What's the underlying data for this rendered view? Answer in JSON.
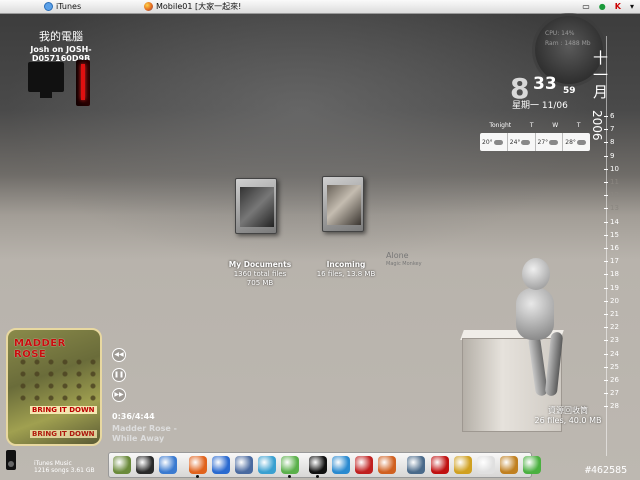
{
  "menubar": {
    "apple_glyph": "",
    "app1": "iTunes",
    "app2": "Mobile01 [大家一起來!",
    "tray_kav": "K",
    "tray_arrow": "▾"
  },
  "mycomputer": {
    "title": "我的電腦",
    "subtitle": "Josh on JOSH-D057160D9B"
  },
  "cpu": {
    "line1": "CPU: 14%",
    "line2": "Ram : 1488 Mb"
  },
  "clock": {
    "hour": "8",
    "minute": "33",
    "second": "59",
    "date": "星期一  11/06",
    "month_chars": [
      "十",
      "一",
      "月"
    ],
    "year": "2006"
  },
  "days": [
    "6",
    "7",
    "8",
    "9",
    "10",
    "11",
    "12",
    "13",
    "14",
    "15",
    "16",
    "17",
    "18",
    "19",
    "20",
    "21",
    "22",
    "23",
    "24",
    "25",
    "26",
    "27",
    "28"
  ],
  "weather": {
    "headers": [
      "Tonight",
      "T",
      "W",
      "T"
    ],
    "temps": [
      "20°",
      "24°",
      "27°",
      "28°"
    ]
  },
  "desktop": {
    "my_documents": {
      "name": "My Documents",
      "line1": "1360  total files",
      "line2": "705 MB"
    },
    "incoming": {
      "name": "Incoming",
      "line1": "16 files, 13.8 MB"
    },
    "alone": "Alone",
    "alone_sub": "Magic Monkey",
    "recycle": {
      "name": "資源回收筒",
      "line1": "26 files, 40.0 MB"
    }
  },
  "itunes": {
    "album_band": "MADDER ROSE",
    "album_title": "BRING IT DOWN",
    "album_title_reflection": "BRING IT DOWN",
    "time": "0:36/4:44",
    "track": "Madder Rose - While Away",
    "library_line1": "iTunes Music",
    "library_line2": "1216 songs   3.61 GB",
    "ctrl_prev": "◀◀",
    "ctrl_pause": "❚❚",
    "ctrl_next": "▶▶"
  },
  "dock_icons": [
    {
      "name": "gameboy-icon",
      "color": "#6a8a3a"
    },
    {
      "name": "monitor-icon",
      "color": "#2a2a2a"
    },
    {
      "name": "screen-icon",
      "color": "#3a7ad0"
    },
    {
      "name": "firefox-icon",
      "color": "#e0621c"
    },
    {
      "name": "internet-explorer-icon",
      "color": "#2a6ad0"
    },
    {
      "name": "thunderbird-icon",
      "color": "#4a6aa0"
    },
    {
      "name": "messenger-icon",
      "color": "#3aa0d0"
    },
    {
      "name": "msn-icon",
      "color": "#5ab04a"
    },
    {
      "name": "ipod-icon",
      "color": "#111111"
    },
    {
      "name": "media-player-icon",
      "color": "#2a8ad0"
    },
    {
      "name": "real-player-icon",
      "color": "#c02020"
    },
    {
      "name": "photo-icon",
      "color": "#d06020"
    },
    {
      "name": "bug-icon",
      "color": "#4a6a8a"
    },
    {
      "name": "no-entry-icon",
      "color": "#c01010"
    },
    {
      "name": "tools-icon",
      "color": "#d0a020"
    },
    {
      "name": "cartoon-icon",
      "color": "#e0e0e0"
    },
    {
      "name": "face-icon",
      "color": "#c08020"
    },
    {
      "name": "recycle-bin-icon",
      "color": "#4ab040"
    }
  ],
  "watermark": "#462585"
}
